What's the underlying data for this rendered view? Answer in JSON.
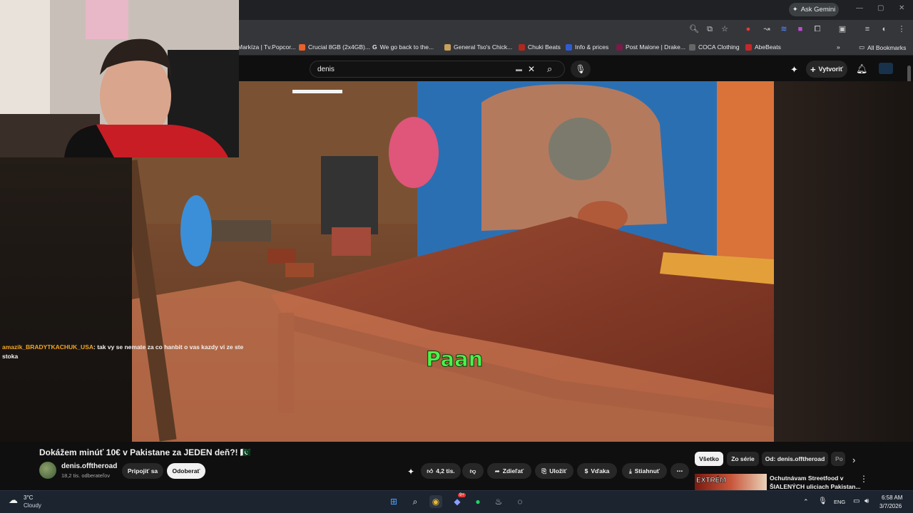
{
  "browser": {
    "ask_gemini": "Ask Gemini",
    "bookmarks": [
      {
        "label": "Markíza | Tv.Popcor...",
        "color": "#e44d26"
      },
      {
        "label": "Crucial 8GB (2x4GB)...",
        "color": "#e8612c"
      },
      {
        "label": "We go back to the...",
        "color": "#f1f1f1"
      },
      {
        "label": "General Tso's Chick...",
        "color": "#c9a05a"
      },
      {
        "label": "Chuki Beats",
        "color": "#b3261e"
      },
      {
        "label": "Info & prices",
        "color": "#2f5bd3"
      },
      {
        "label": "Post Malone | Drake...",
        "color": "#7a1a4a"
      },
      {
        "label": "COCA Clothing",
        "color": "#2b2b2b"
      },
      {
        "label": "AbeBeats",
        "color": "#c62828"
      }
    ],
    "all_bookmarks": "All Bookmarks",
    "more_bookmarks": "»"
  },
  "youtube": {
    "search_value": "denis",
    "create_label": "Vytvoriť",
    "video": {
      "caption": "Paan",
      "title": "Dokážem minúť 10€ v Pakistane za JEDEN deň?! 🇵🇰",
      "channel": "denis.offtheroad",
      "subscribers": "18,2 tis. odberateľov",
      "join_label": "Pripojiť sa",
      "subscribe_label": "Odoberať",
      "likes": "4,2 tis.",
      "share_label": "Zdieľať",
      "save_label": "Uložiť",
      "thanks_label": "Vďaka",
      "download_label": "Stiahnuť"
    },
    "chips": [
      "Všetko",
      "Zo série",
      "Od: denis.offtheroad",
      "Po"
    ],
    "recommendation": {
      "thumb_label": "EXTRÉM",
      "title_line1": "Ochutnávam Streetfood v",
      "title_line2": "ŠIALENÝCH uliciach Pakistan..."
    }
  },
  "stream": {
    "chat_user": "amazik_BRADYTKACHUK_USA",
    "chat_text": ": tak vy se nemate za co hanbit o vas kazdy vi ze ste stoka"
  },
  "taskbar": {
    "weather_temp": "3°C",
    "weather_desc": "Cloudy",
    "lang": "ENG",
    "time": "6:58 AM",
    "date": "3/7/2026",
    "discord_badge": "9+"
  }
}
